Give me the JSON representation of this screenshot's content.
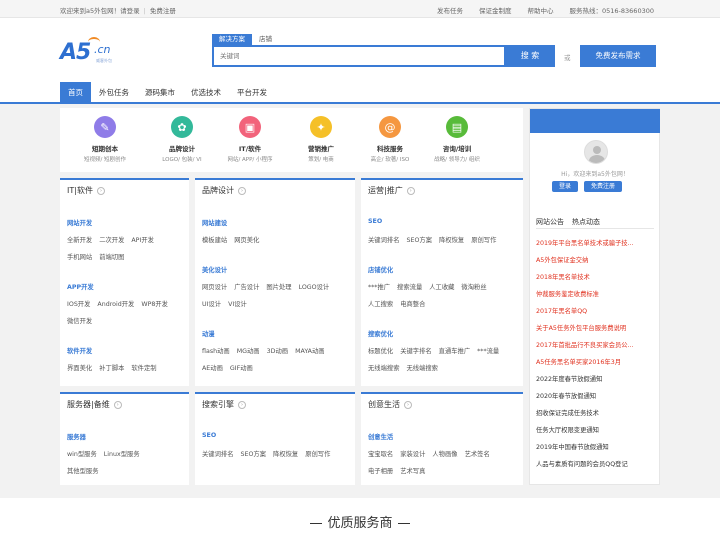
{
  "topbar": {
    "welcome": "欢迎来到a5外包网！请登录",
    "register": "免费注册",
    "links": [
      "发布任务",
      "保证金制度",
      "帮助中心"
    ],
    "hotline": "服务热线：0516-83660300"
  },
  "logo": {
    "text": "A5",
    "suffix": ".cn",
    "slogan": "威客外包"
  },
  "search": {
    "tabs": [
      "解决方案",
      "店铺"
    ],
    "placeholder": "关键词",
    "button": "搜 索",
    "or": "或",
    "publish": "免费发布需求"
  },
  "nav": [
    "首页",
    "外包任务",
    "源码集市",
    "优选技术",
    "平台开发"
  ],
  "services": [
    {
      "title": "短期创本",
      "sub": "短视频/ 短剧创作",
      "color": "#8f7ce8",
      "icon": "✎"
    },
    {
      "title": "品牌设计",
      "sub": "LOGO/ 包装/ VI",
      "color": "#33b99a",
      "icon": "✿"
    },
    {
      "title": "IT/软件",
      "sub": "网站/ APP/ 小程序",
      "color": "#f2637b",
      "icon": "▣"
    },
    {
      "title": "营销推广",
      "sub": "策划/ 电商",
      "color": "#f5c028",
      "icon": "✦"
    },
    {
      "title": "科技服务",
      "sub": "高企/ 软著/ ISO",
      "color": "#f59740",
      "icon": "@"
    },
    {
      "title": "咨询/培训",
      "sub": "战略/ 领导力/ 组织",
      "color": "#58bb3a",
      "icon": "▤"
    }
  ],
  "sidebar": {
    "welcome": "Hi，欢迎来到a5外包网！",
    "login": "登录",
    "register": "免费注册",
    "tabs": [
      "网站公告",
      "热点动态"
    ],
    "news": [
      {
        "text": "2019年平台黑名单技术或骗子技...",
        "color": "red"
      },
      {
        "text": "A5外包保证金交纳",
        "color": "red"
      },
      {
        "text": "2018年黑名单技术",
        "color": "red"
      },
      {
        "text": "仲裁服务鉴定收费标准",
        "color": "red"
      },
      {
        "text": "2017年黑名单QQ",
        "color": "red"
      },
      {
        "text": "关于A5任务外包平台服务费说明",
        "color": "red"
      },
      {
        "text": "2017年首批品行不良买家会员公...",
        "color": "red"
      },
      {
        "text": "A5任务黑名单买家2016年3月",
        "color": "red"
      },
      {
        "text": "2022年度春节放假通知",
        "color": "dark"
      },
      {
        "text": "2020年春节放假通知",
        "color": "dark"
      },
      {
        "text": "招收保证完成任务技术",
        "color": "dark"
      },
      {
        "text": "任务大厅权限变更通知",
        "color": "dark"
      },
      {
        "text": "2019年中国春节放假通知",
        "color": "dark"
      },
      {
        "text": "人品与素质有问题的会员QQ登记",
        "color": "dark"
      }
    ]
  },
  "cards": {
    "it": {
      "title": "IT|软件",
      "groups": [
        {
          "name": "网站开发",
          "rows": [
            [
              "全新开发",
              "二次开发",
              "API开发"
            ],
            [
              "手机网站",
              "前端切图"
            ]
          ]
        },
        {
          "name": "APP开发",
          "rows": [
            [
              "IOS开发",
              "Android开发",
              "WP8开发"
            ],
            [
              "微信开发"
            ]
          ]
        },
        {
          "name": "软件开发",
          "rows": [
            [
              "界面美化",
              "补丁脚本",
              "软件定制"
            ]
          ]
        }
      ]
    },
    "brand": {
      "title": "品牌设计",
      "groups": [
        {
          "name": "网站建设",
          "rows": [
            [
              "模板建站",
              "网页美化"
            ]
          ]
        },
        {
          "name": "美化设计",
          "rows": [
            [
              "网页设计",
              "广告设计",
              "图片处理",
              "LOGO设计"
            ],
            [
              "UI设计",
              "VI设计"
            ]
          ]
        },
        {
          "name": "动漫",
          "rows": [
            [
              "flash动画",
              "MG动画",
              "3D动画",
              "MAYA动画"
            ],
            [
              "AE动画",
              "GIF动画"
            ]
          ]
        }
      ]
    },
    "ops": {
      "title": "运营|推广",
      "groups": [
        {
          "name": "SEO",
          "rows": [
            [
              "关键词排名",
              "SEO方案",
              "降权恢复",
              "原创写作"
            ]
          ]
        },
        {
          "name": "店铺优化",
          "rows": [
            [
              "***推广",
              "搜索流量",
              "人工收藏",
              "微淘粉丝"
            ],
            [
              "人工搜索",
              "电商整合"
            ]
          ]
        },
        {
          "name": "搜索优化",
          "rows": [
            [
              "标题优化",
              "关键字排名",
              "直通车推广",
              "***流量"
            ],
            [
              "无线端搜索",
              "无线端搜索"
            ]
          ]
        }
      ]
    },
    "server": {
      "title": "服务器|备维",
      "groups": [
        {
          "name": "服务器",
          "rows": [
            [
              "win型服务",
              "Linux型服务"
            ],
            [
              "其他型服务"
            ]
          ]
        }
      ]
    },
    "search": {
      "title": "搜索引擎",
      "groups": [
        {
          "name": "SEO",
          "rows": [
            [
              "关键词排名",
              "SEO方案",
              "降权恢复",
              "原创写作"
            ]
          ]
        }
      ]
    },
    "life": {
      "title": "创意生活",
      "groups": [
        {
          "name": "创意生活",
          "rows": [
            [
              "宝宝取名",
              "家装设计",
              "人物画像",
              "艺术签名"
            ],
            [
              "电子相册",
              "艺术写真"
            ]
          ]
        }
      ]
    }
  },
  "section": {
    "title": "优质服务商"
  }
}
